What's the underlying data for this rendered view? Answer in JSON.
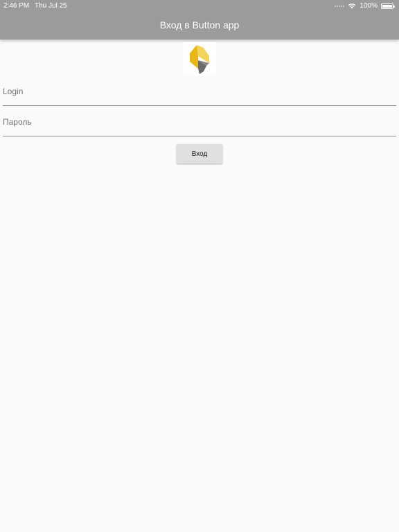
{
  "status_bar": {
    "time": "2:46 PM",
    "date": "Thu Jul 25",
    "battery": "100%",
    "battery_level": 1.0
  },
  "app_bar": {
    "title": "Вход в Button app"
  },
  "logo": {
    "icon": "button-app-logo",
    "colors": {
      "yellow_light": "#f3d35a",
      "yellow_dark": "#e8b715",
      "gray": "#6b6b6b"
    }
  },
  "form": {
    "login": {
      "placeholder": "Login",
      "value": ""
    },
    "password": {
      "placeholder": "Пароль",
      "value": ""
    },
    "submit_label": "Вход"
  },
  "colors": {
    "app_bar": "#9b9b9b",
    "background": "#fafafa",
    "button": "#e0e0e0"
  }
}
